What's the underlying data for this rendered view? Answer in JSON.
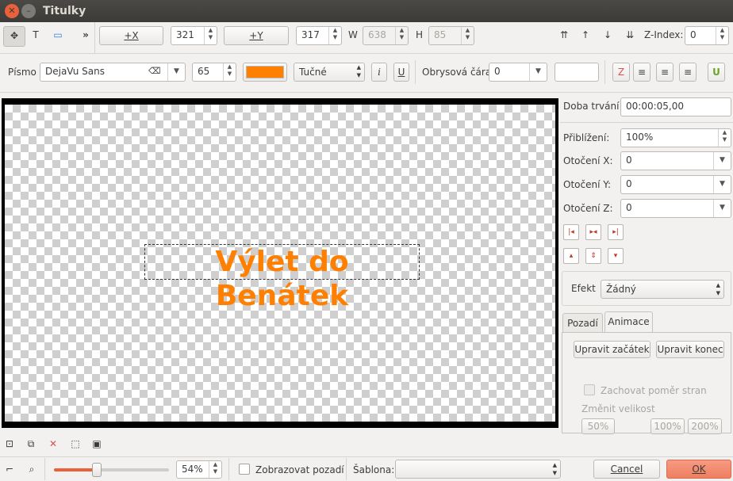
{
  "window": {
    "title": "Titulky",
    "close_glyph": "✕",
    "min_glyph": "–"
  },
  "toolbar1": {
    "x_button": "+X",
    "x_value": "321",
    "y_button": "+Y",
    "y_value": "317",
    "w_label": "W",
    "w_value": "638",
    "h_label": "H",
    "h_value": "85",
    "zindex_label": "Z-Index:",
    "zindex_value": "0",
    "more_glyph": "»"
  },
  "toolbar2": {
    "font_label": "Písmo",
    "font_value": "DejaVu Sans",
    "font_size": "65",
    "text_color": "#ff8000",
    "weight_value": "Tučné",
    "outline_label": "Obrysová čára",
    "outline_value": "0"
  },
  "canvas": {
    "title_text": "Výlet do Benátek",
    "title_color": "#ff8000"
  },
  "right_panel": {
    "duration_label": "Doba trvání",
    "duration_value": "00:00:05,00",
    "zoom_label": "Přiblížení:",
    "zoom_value": "100%",
    "rot_x_label": "Otočení X:",
    "rot_x_value": "0",
    "rot_y_label": "Otočení Y:",
    "rot_y_value": "0",
    "rot_z_label": "Otočení Z:",
    "rot_z_value": "0",
    "effect_label": "Efekt",
    "effect_value": "Žádný",
    "tabs": [
      "Pozadí",
      "Animace"
    ],
    "edit_start": "Upravit začátek",
    "edit_end": "Upravit konec",
    "keep_ratio": "Zachovat poměr stran",
    "resize_label": "Změnit velikost",
    "size_50": "50%",
    "size_100": "100%",
    "size_200": "200%"
  },
  "bottom": {
    "zoom_value": "54%",
    "show_bg_label": "Zobrazovat pozadí",
    "template_label": "Šablona:",
    "template_value": "",
    "cancel": "Cancel",
    "ok": "OK",
    "zoom_slider_fraction": 0.37
  }
}
